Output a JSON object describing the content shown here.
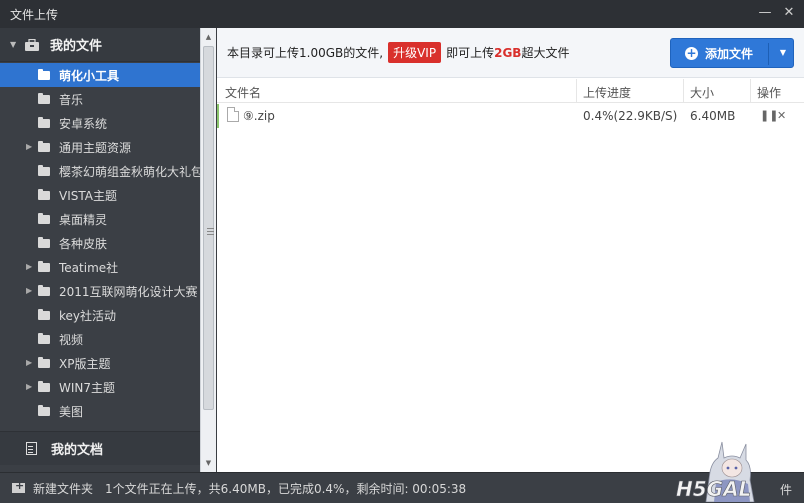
{
  "window": {
    "title": "文件上传"
  },
  "sidebar": {
    "header": "我的文件",
    "items": [
      {
        "label": "萌化小工具",
        "selected": true,
        "expandable": false
      },
      {
        "label": "音乐",
        "expandable": false
      },
      {
        "label": "安卓系统",
        "expandable": false
      },
      {
        "label": "通用主题资源",
        "expandable": true
      },
      {
        "label": "樱茶幻萌组金秋萌化大礼包",
        "expandable": false
      },
      {
        "label": "VISTA主题",
        "expandable": false
      },
      {
        "label": "桌面精灵",
        "expandable": false
      },
      {
        "label": "各种皮肤",
        "expandable": false
      },
      {
        "label": "Teatime社",
        "expandable": true
      },
      {
        "label": "2011互联网萌化设计大赛",
        "expandable": true
      },
      {
        "label": "key社活动",
        "expandable": false
      },
      {
        "label": "视频",
        "expandable": false
      },
      {
        "label": "XP版主题",
        "expandable": true
      },
      {
        "label": "WIN7主题",
        "expandable": true
      },
      {
        "label": "美图",
        "expandable": false
      }
    ],
    "footer": "我的文档"
  },
  "banner": {
    "prefix": "本目录可上传1.00GB的文件,",
    "vip_label": "升级VIP",
    "middle": "即可上传",
    "highlight": "2GB",
    "suffix": "超大文件",
    "add_button": "添加文件"
  },
  "table": {
    "headers": {
      "name": "文件名",
      "progress": "上传进度",
      "size": "大小",
      "action": "操作"
    },
    "rows": [
      {
        "name": "⑨.zip",
        "progress": "0.4%(22.9KB/S)",
        "size": "6.40MB"
      }
    ]
  },
  "status": {
    "new_folder": "新建文件夹",
    "text": "1个文件正在上传，共6.40MB，已完成0.4%，剩余时间: 00:05:38",
    "right": "件"
  },
  "logo": {
    "text": "H5GAL"
  },
  "colors": {
    "accent": "#2f78d8",
    "vip": "#d9302c",
    "sidebar": "#3b3f45"
  }
}
